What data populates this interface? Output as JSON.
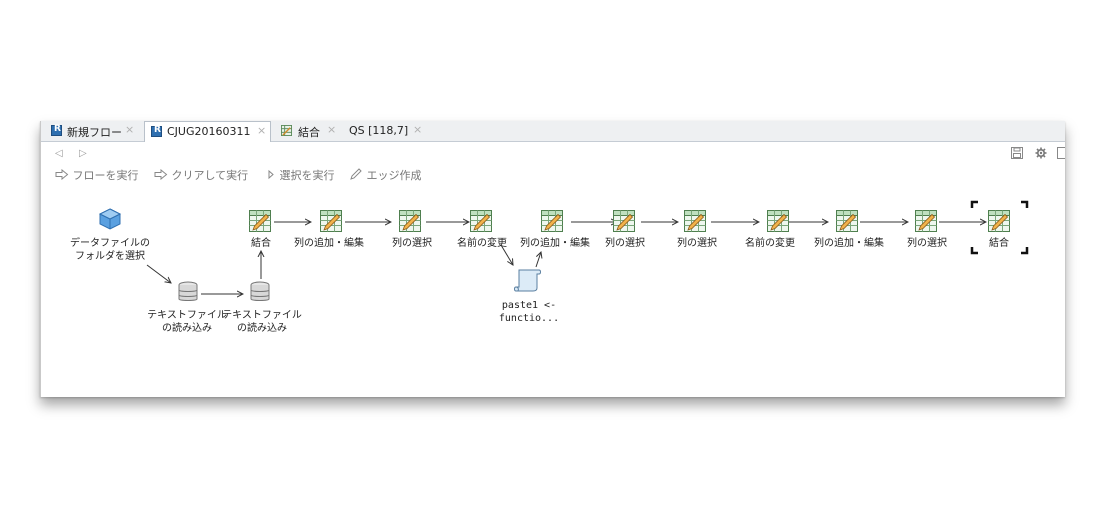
{
  "tabs": [
    {
      "label": "新規フロー",
      "icon": "r-doc-icon",
      "close": "×"
    },
    {
      "label": "CJUG20160311",
      "icon": "r-doc-icon",
      "close": "×"
    },
    {
      "label": "結合",
      "icon": "table-icon",
      "close": "×"
    },
    {
      "label": "QS [118,7]",
      "icon": "none",
      "close": "×"
    }
  ],
  "nav": {
    "back": "◁",
    "forward": "▷"
  },
  "toolbar": {
    "run_flow": "フローを実行",
    "clear_run": "クリアして実行",
    "run_selection": "選択を実行",
    "create_edge": "エッジ作成"
  },
  "nodes": {
    "data_folder": "データファイルの\nフォルダを選択",
    "read_text_1": "テキストファイル\nの読み込み",
    "read_text_2": "テキストファイル\nの読み込み",
    "join_1": "結合",
    "add_col_1": "列の追加・編集",
    "select_col_1": "列の選択",
    "rename_1": "名前の変更",
    "script": "paste1 <-\nfunctio...",
    "add_col_2": "列の追加・編集",
    "select_col_2": "列の選択",
    "select_col_3": "列の選択",
    "rename_2": "名前の変更",
    "add_col_3": "列の追加・編集",
    "select_col_4": "列の選択",
    "join_2": "結合"
  },
  "colors": {
    "tab_bar": "#eef0f2",
    "accent": "#2e6fb0",
    "node_green": "#6fb36f",
    "cube": "#4a90d9"
  }
}
